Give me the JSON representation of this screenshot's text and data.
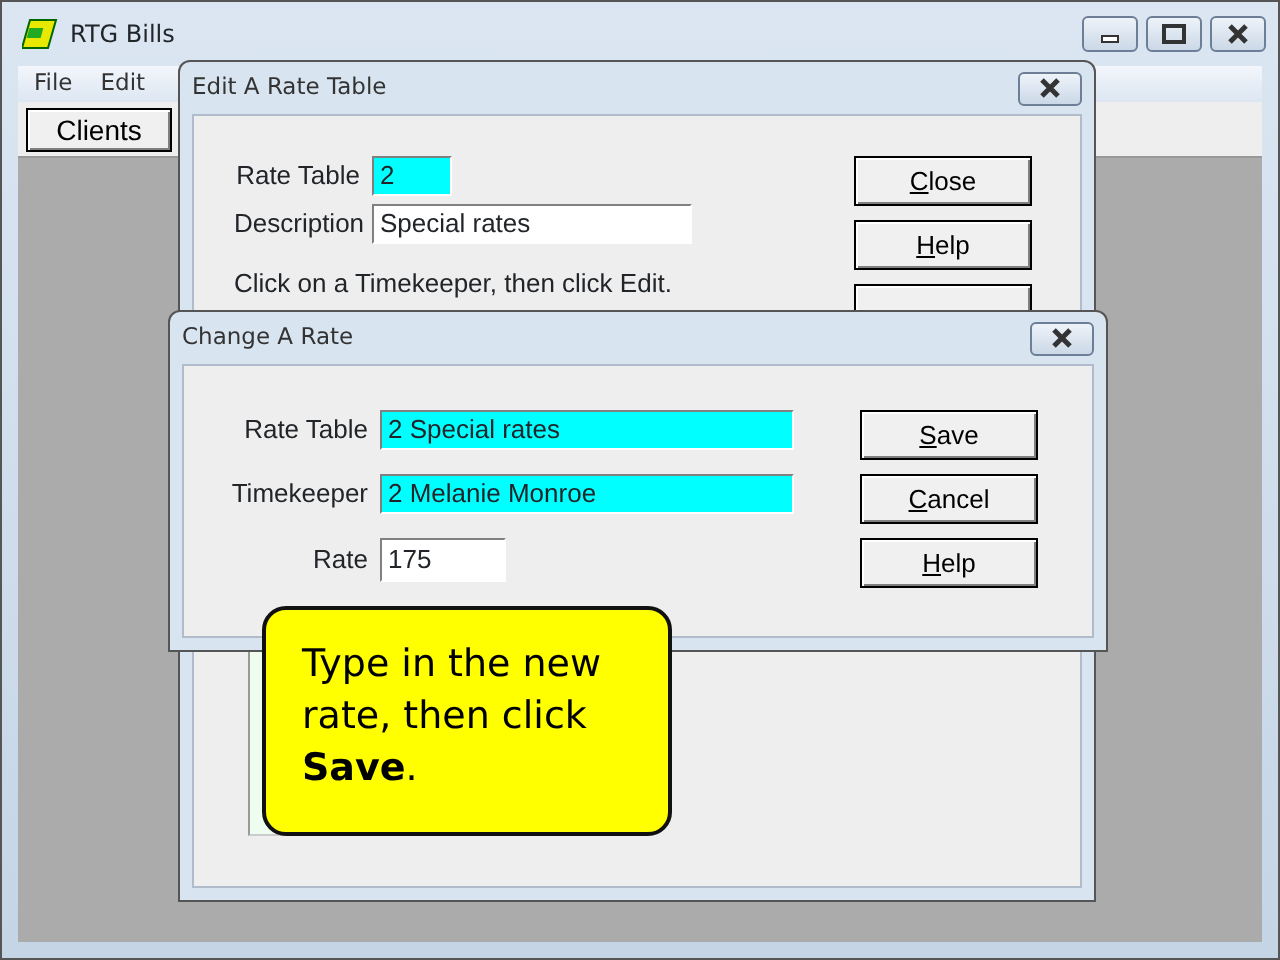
{
  "window": {
    "title": "RTG Bills"
  },
  "menu": [
    "File",
    "Edit"
  ],
  "toolbar": {
    "buttons": [
      "Clients"
    ]
  },
  "edit_dialog": {
    "title": "Edit A Rate Table",
    "fields": [
      {
        "label": "Rate Table",
        "value": "2",
        "kind": "key"
      },
      {
        "label": "Description",
        "value": "Special rates",
        "kind": "text"
      }
    ],
    "instruction": "Click on a Timekeeper, then click Edit.",
    "buttons": [
      {
        "label": "Close",
        "mnemonic_underlined": true
      },
      {
        "label": "Help",
        "mnemonic_underlined": true
      }
    ]
  },
  "change_dialog": {
    "title": "Change A Rate",
    "fields": [
      {
        "label": "Rate Table",
        "value": "2  Special rates",
        "kind": "key"
      },
      {
        "label": "Timekeeper",
        "value": "2  Melanie Monroe",
        "kind": "key"
      },
      {
        "label": "Rate",
        "value": "175",
        "kind": "text"
      }
    ],
    "buttons": [
      {
        "label": "Save",
        "mnemonic_underlined": true
      },
      {
        "label": "Cancel",
        "mnemonic_underlined": true
      },
      {
        "label": "Help",
        "mnemonic_underlined": true
      }
    ]
  },
  "callout": {
    "text": "Type in the new rate, then click **Save**."
  }
}
